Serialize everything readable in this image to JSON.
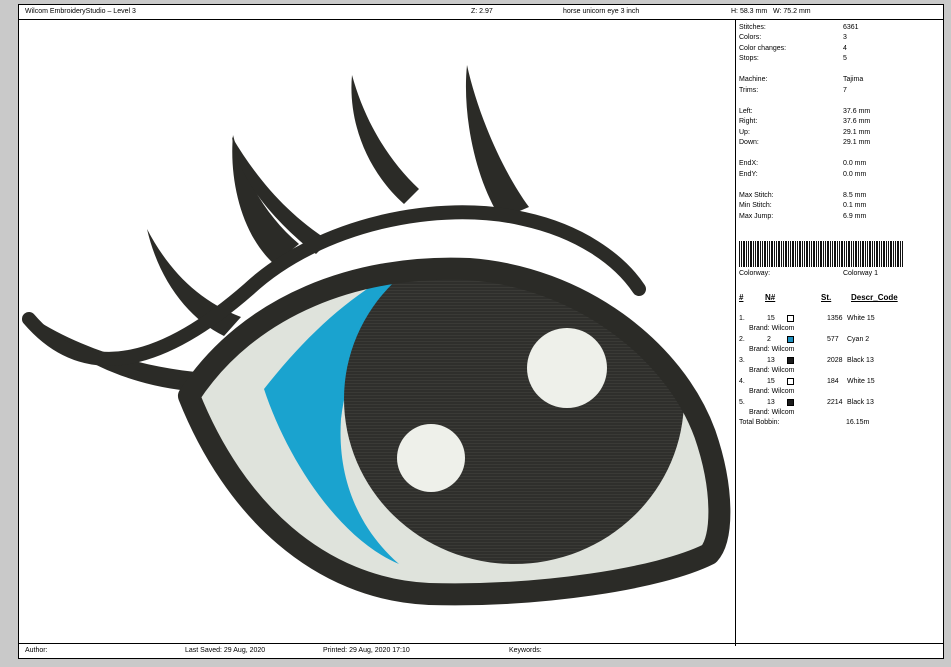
{
  "header": {
    "title": "Wilcom EmbroideryStudio – Level 3",
    "zoom": "Z: 2.97",
    "design_name": "horse unicorn eye 3 inch",
    "height": "H: 58.3 mm",
    "width": "W: 75.2 mm"
  },
  "stats": [
    {
      "label": "Stitches:",
      "value": "6361"
    },
    {
      "label": "Colors:",
      "value": "3"
    },
    {
      "label": "Color changes:",
      "value": "4"
    },
    {
      "label": "Stops:",
      "value": "5"
    },
    {
      "label": "Machine:",
      "value": "Tajima"
    },
    {
      "label": "Trims:",
      "value": "7"
    },
    {
      "label": "Left:",
      "value": "37.6 mm"
    },
    {
      "label": "Right:",
      "value": "37.6 mm"
    },
    {
      "label": "Up:",
      "value": "29.1 mm"
    },
    {
      "label": "Down:",
      "value": "29.1 mm"
    },
    {
      "label": "EndX:",
      "value": "0.0 mm"
    },
    {
      "label": "EndY:",
      "value": "0.0 mm"
    },
    {
      "label": "Max Stitch:",
      "value": "8.5 mm"
    },
    {
      "label": "Min Stitch:",
      "value": "0.1 mm"
    },
    {
      "label": "Max Jump:",
      "value": "6.9 mm"
    }
  ],
  "colorway": {
    "label": "Colorway:",
    "value": "Colorway 1"
  },
  "table": {
    "headers": {
      "index": "#",
      "needle": "N#",
      "stitches": "St.",
      "descr": "Descr_Code"
    },
    "rows": [
      {
        "index": "1.",
        "needle": "15",
        "color": "#ffffff",
        "stitches": "1356",
        "descr": "White 15",
        "brand": "Brand: Wilcom"
      },
      {
        "index": "2.",
        "needle": "2",
        "color": "#1e90c0",
        "stitches": "577",
        "descr": "Cyan 2",
        "brand": "Brand: Wilcom"
      },
      {
        "index": "3.",
        "needle": "13",
        "color": "#1a1a1a",
        "stitches": "2028",
        "descr": "Black 13",
        "brand": "Brand: Wilcom"
      },
      {
        "index": "4.",
        "needle": "15",
        "color": "#ffffff",
        "stitches": "184",
        "descr": "White 15",
        "brand": "Brand: Wilcom"
      },
      {
        "index": "5.",
        "needle": "13",
        "color": "#1a1a1a",
        "stitches": "2214",
        "descr": "Black 13",
        "brand": "Brand: Wilcom"
      }
    ],
    "total_label": "Total Bobbin:",
    "total_value": "16.15m"
  },
  "footer": {
    "author": "Author:",
    "last_saved": "Last Saved: 29 Aug, 2020",
    "printed": "Printed: 29 Aug, 2020 17:10",
    "keywords": "Keywords:"
  },
  "colors": {
    "thread_black": "#2b2b27",
    "thread_cyan": "#1aa3cf",
    "thread_white": "#dfe3dc"
  }
}
